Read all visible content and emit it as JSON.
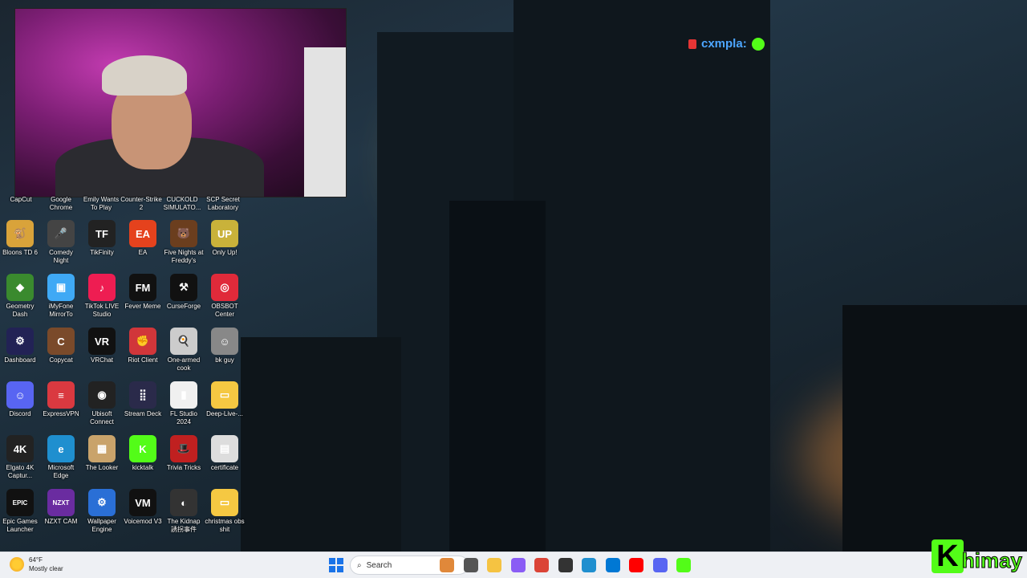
{
  "chat": {
    "username": "cxmpla:"
  },
  "top_row_labels": [
    "CapCut",
    "Google Chrome",
    "Emily Wants To Play",
    "Counter-Strike 2",
    "CUCKOLD SIMULATO...",
    "SCP Secret Laboratory"
  ],
  "desktop_icons": [
    {
      "label": "Bloons TD 6",
      "color": "#d9a33a",
      "glyph": "🐒"
    },
    {
      "label": "Comedy Night",
      "color": "#444",
      "glyph": "🎤"
    },
    {
      "label": "TikFinity",
      "color": "#222",
      "glyph": "TF"
    },
    {
      "label": "EA",
      "color": "#e5421d",
      "glyph": "EA"
    },
    {
      "label": "Five Nights at Freddy's",
      "color": "#6b3e1e",
      "glyph": "🐻"
    },
    {
      "label": "Only Up!",
      "color": "#c9b23a",
      "glyph": "UP"
    },
    {
      "label": "Geometry Dash",
      "color": "#3a8a2e",
      "glyph": "◆"
    },
    {
      "label": "iMyFone MirrorTo",
      "color": "#3fa9f5",
      "glyph": "▣"
    },
    {
      "label": "TikTok LIVE Studio",
      "color": "#ee1d52",
      "glyph": "♪"
    },
    {
      "label": "Fever Meme",
      "color": "#111",
      "glyph": "FM"
    },
    {
      "label": "CurseForge",
      "color": "#111",
      "glyph": "⚒"
    },
    {
      "label": "OBSBOT Center",
      "color": "#e02a3a",
      "glyph": "◎"
    },
    {
      "label": "Dashboard",
      "color": "#225",
      "glyph": "⚙"
    },
    {
      "label": "Copycat",
      "color": "#7a4a2a",
      "glyph": "C"
    },
    {
      "label": "VRChat",
      "color": "#111",
      "glyph": "VR"
    },
    {
      "label": "Riot Client",
      "color": "#d1363a",
      "glyph": "✊"
    },
    {
      "label": "One-armed cook",
      "color": "#ccc",
      "glyph": "🍳"
    },
    {
      "label": "bk guy",
      "color": "#888",
      "glyph": "☺"
    },
    {
      "label": "Discord",
      "color": "#5865f2",
      "glyph": "☺"
    },
    {
      "label": "ExpressVPN",
      "color": "#da3940",
      "glyph": "≡"
    },
    {
      "label": "Ubisoft Connect",
      "color": "#222",
      "glyph": "◉"
    },
    {
      "label": "Stream Deck",
      "color": "#2a2a4a",
      "glyph": "⣿"
    },
    {
      "label": "FL Studio 2024",
      "color": "#f0f0f0",
      "glyph": "▮"
    },
    {
      "label": "Deep-Live-...",
      "color": "#f5c842",
      "glyph": "▭"
    },
    {
      "label": "Elgato 4K Captur...",
      "color": "#222",
      "glyph": "4K"
    },
    {
      "label": "Microsoft Edge",
      "color": "#1f8fcf",
      "glyph": "e"
    },
    {
      "label": "The Looker",
      "color": "#c9a36b",
      "glyph": "▦"
    },
    {
      "label": "kicktalk",
      "color": "#53fc18",
      "glyph": "K"
    },
    {
      "label": "Trivia Tricks",
      "color": "#c02020",
      "glyph": "🎩"
    },
    {
      "label": "certificate",
      "color": "#ddd",
      "glyph": "▤"
    },
    {
      "label": "Epic Games Launcher",
      "color": "#111",
      "glyph": "EPIC"
    },
    {
      "label": "NZXT CAM",
      "color": "#6a2ca0",
      "glyph": "NZXT"
    },
    {
      "label": "Wallpaper Engine",
      "color": "#2a6fd6",
      "glyph": "⚙"
    },
    {
      "label": "Voicemod V3",
      "color": "#111",
      "glyph": "VM"
    },
    {
      "label": "The Kidnap 誘拐事件",
      "color": "#333",
      "glyph": "◐"
    },
    {
      "label": "christmas obs shit",
      "color": "#f5c842",
      "glyph": "▭"
    }
  ],
  "taskbar": {
    "weather_temp": "64°F",
    "weather_desc": "Mostly clear",
    "search_placeholder": "Search",
    "apps": [
      {
        "name": "people-app",
        "color": "#e0883a"
      },
      {
        "name": "task-view",
        "color": "#555"
      },
      {
        "name": "file-explorer",
        "color": "#f5c342"
      },
      {
        "name": "copilot",
        "color": "#8a5cf5"
      },
      {
        "name": "chrome",
        "color": "#db4437"
      },
      {
        "name": "obs",
        "color": "#333"
      },
      {
        "name": "edge",
        "color": "#1f8fcf"
      },
      {
        "name": "store",
        "color": "#0078d4"
      },
      {
        "name": "youtube",
        "color": "#ff0000"
      },
      {
        "name": "discord",
        "color": "#5865f2"
      },
      {
        "name": "kick",
        "color": "#53fc18"
      }
    ]
  },
  "brand": {
    "text": "himay"
  },
  "colors": {
    "kick_green": "#53fc18",
    "chat_blue": "#4da6ff"
  }
}
